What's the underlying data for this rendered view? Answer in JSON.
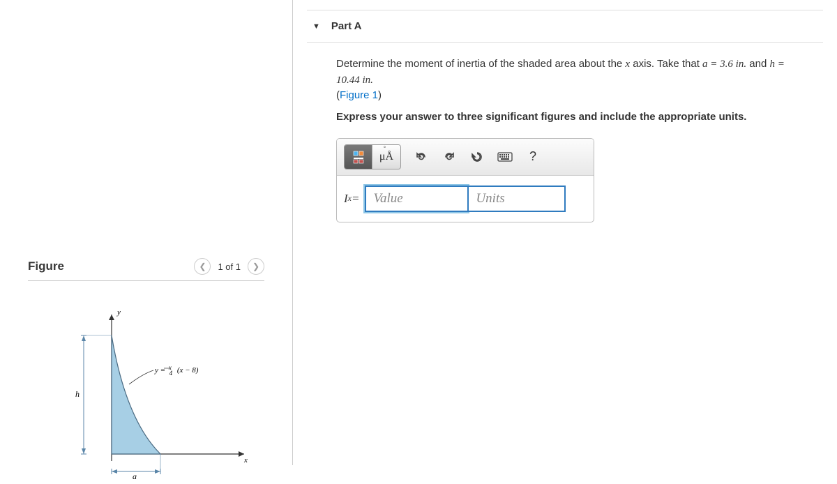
{
  "figure": {
    "title": "Figure",
    "counter": "1 of 1",
    "y_axis": "y",
    "x_axis": "x",
    "h_label": "h",
    "a_label": "a",
    "curve_label_prefix": "y = ",
    "curve_label_frac_top": "x",
    "curve_label_frac_bot": "4",
    "curve_label_suffix": " (x − 8)"
  },
  "part": {
    "name": "Part A",
    "q1a": "Determine the moment of inertia of the shaded area about the ",
    "q1_var": "x",
    "q1b": " axis. Take that ",
    "q1_a_eq": "a = 3.6 in.",
    "q1_and": " and ",
    "q1_h_eq": "h = 10.44 in.",
    "fig_link": "Figure 1",
    "instruction": "Express your answer to three significant figures and include the appropriate units.",
    "eq_label_I": "I",
    "eq_label_sub": "x",
    "eq_label_eq": " = ",
    "value_ph": "Value",
    "units_ph": "Units",
    "mu_A": "μÅ",
    "help": "?"
  }
}
